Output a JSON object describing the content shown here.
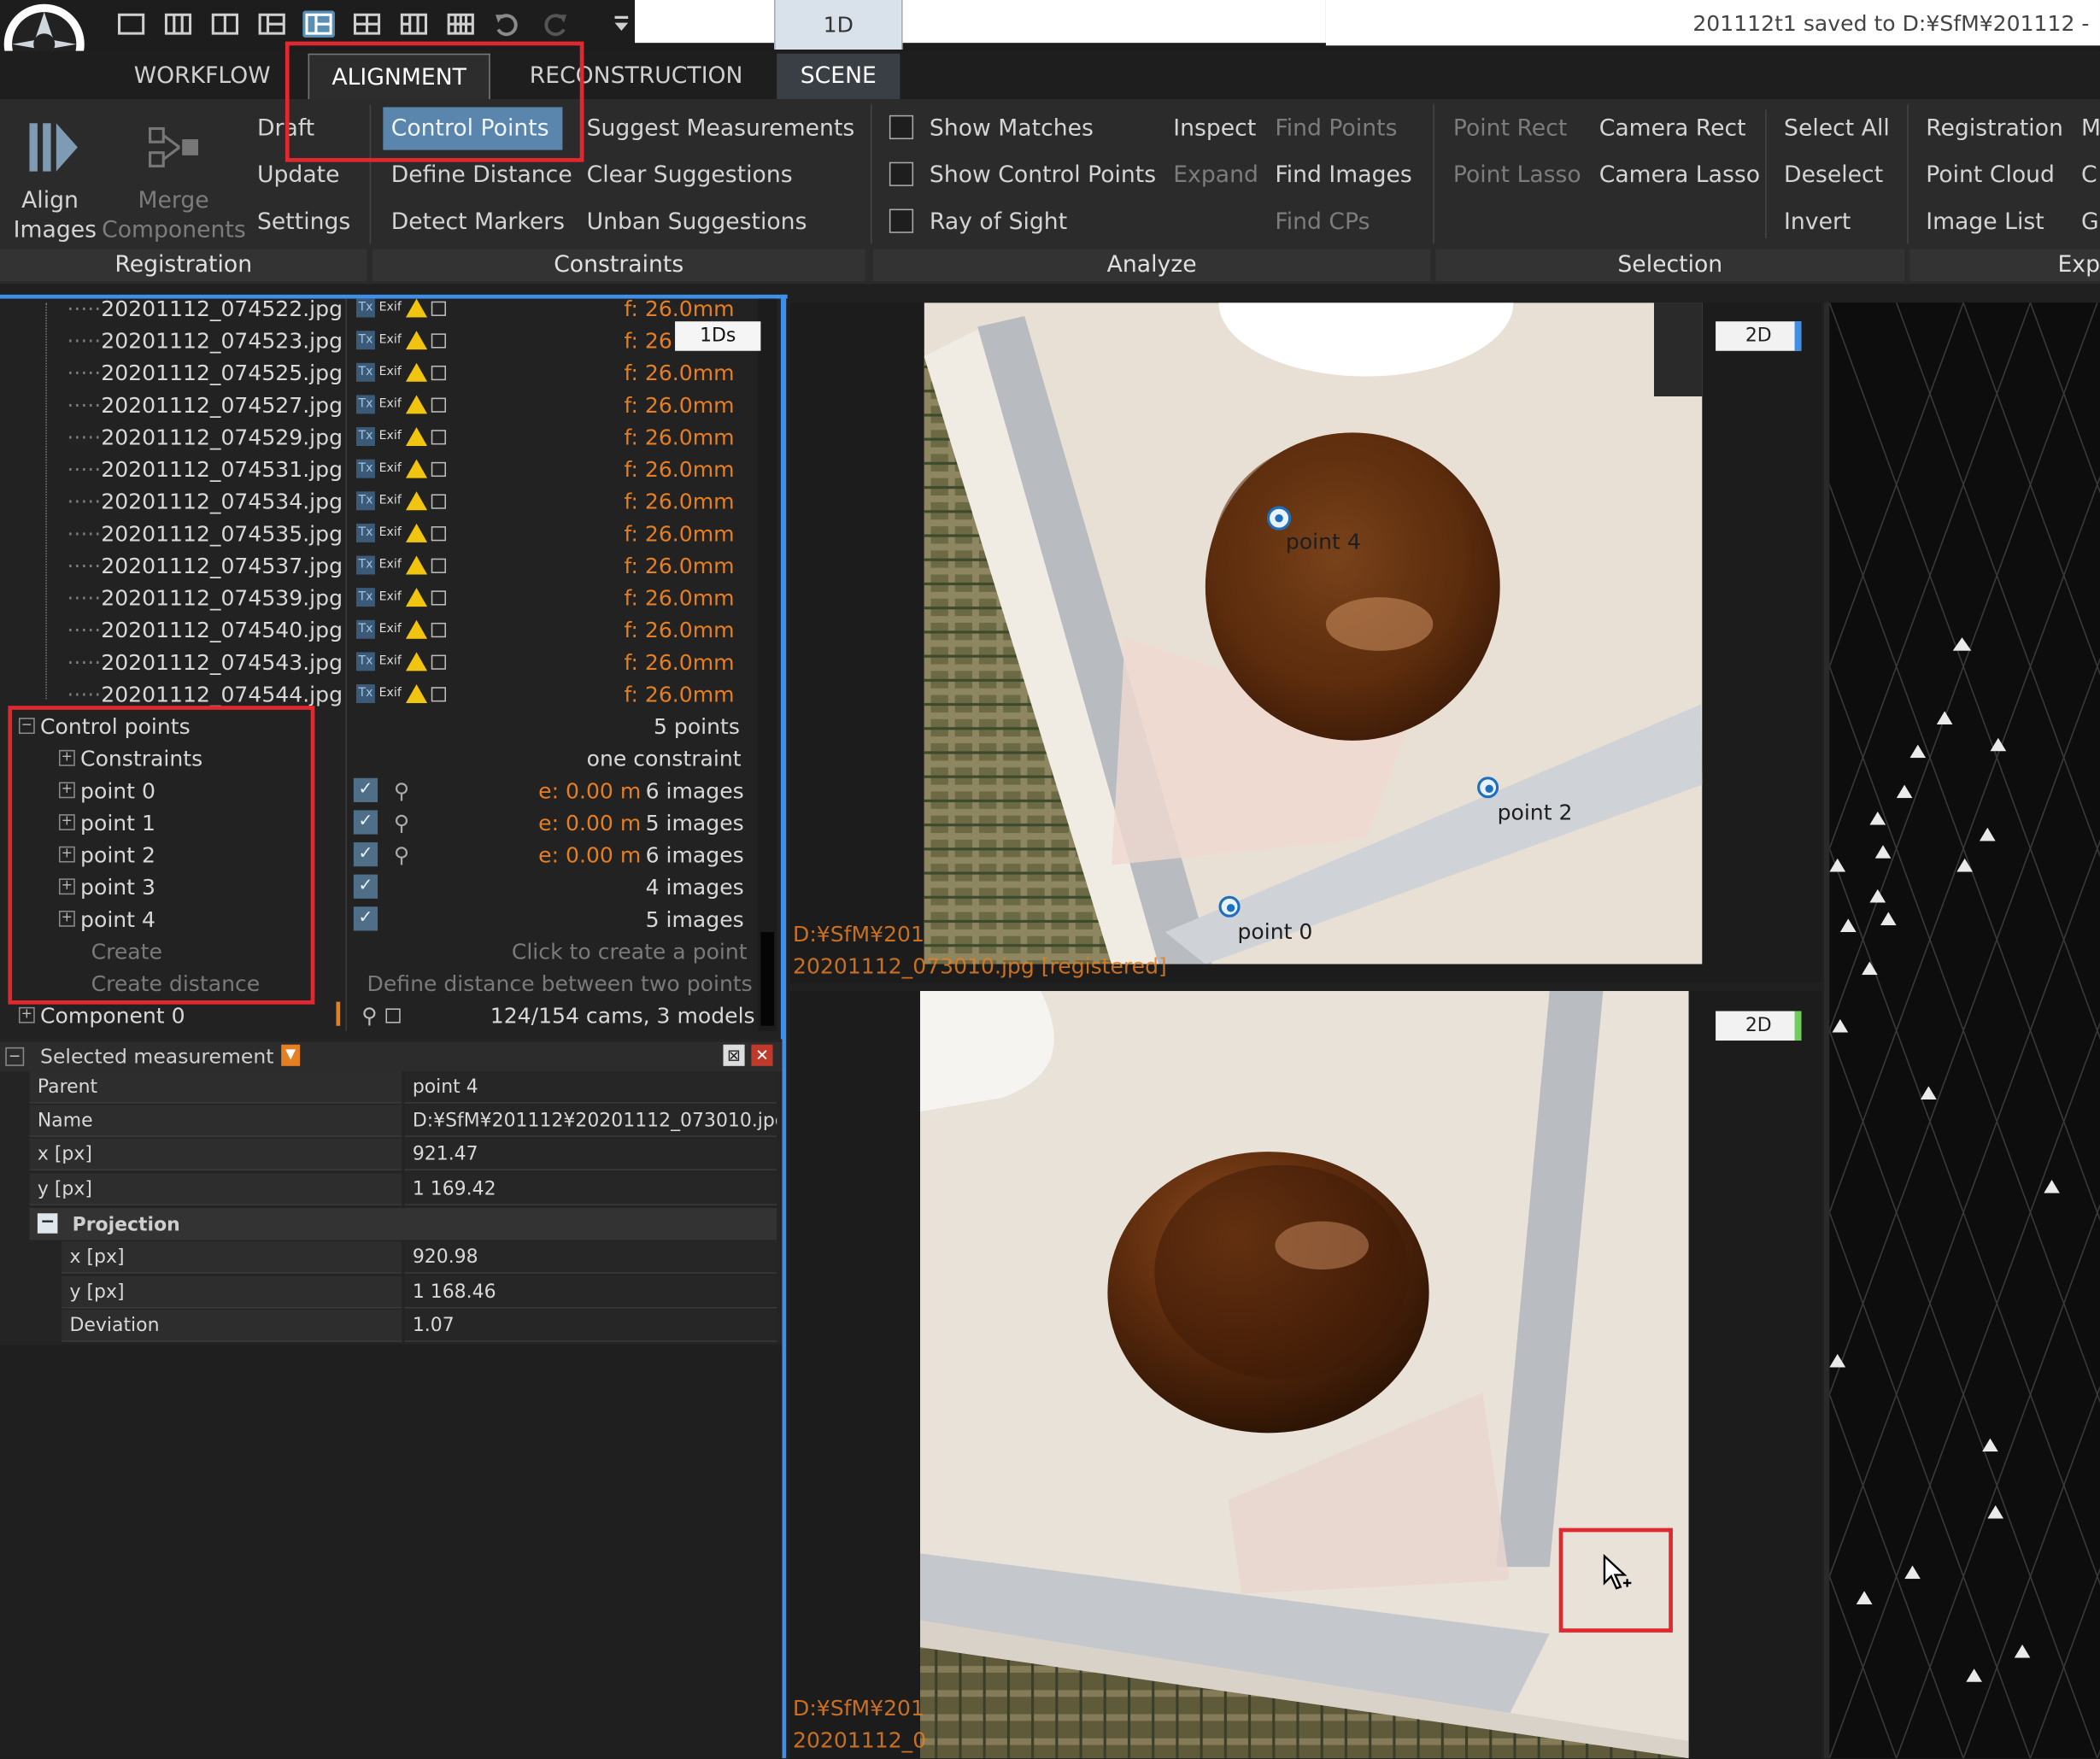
{
  "window": {
    "save_status": "201112t1 saved to D:¥SfM¥201112 -"
  },
  "quick_access": {
    "tab_1d": "1D",
    "icons": [
      "layout-1-icon",
      "layout-2-icon",
      "layout-3-icon",
      "layout-4-icon",
      "layout-5-icon",
      "layout-6-icon",
      "layout-7-icon",
      "layout-8-icon",
      "undo-icon",
      "redo-icon",
      "menu-icon"
    ]
  },
  "tabs": [
    "WORKFLOW",
    "ALIGNMENT",
    "RECONSTRUCTION",
    "SCENE"
  ],
  "ribbon": {
    "registration": {
      "align_images": [
        "Align",
        "Images"
      ],
      "merge_components": [
        "Merge",
        "Components"
      ],
      "draft": "Draft",
      "update": "Update",
      "settings": "Settings",
      "group": "Registration"
    },
    "constraints": {
      "control_points": "Control Points",
      "define_distance": "Define Distance",
      "detect_markers": "Detect Markers",
      "suggest_measurements": "Suggest Measurements",
      "clear_suggestions": "Clear Suggestions",
      "unban_suggestions": "Unban Suggestions",
      "group": "Constraints"
    },
    "analyze": {
      "show_matches": "Show Matches",
      "show_control_points": "Show Control Points",
      "ray_of_sight": "Ray of Sight",
      "inspect": "Inspect",
      "expand": "Expand",
      "find_points": "Find Points",
      "find_images": "Find Images",
      "find_cps": "Find CPs",
      "group": "Analyze"
    },
    "selection": {
      "point_rect": "Point Rect",
      "point_lasso": "Point Lasso",
      "camera_rect": "Camera Rect",
      "camera_lasso": "Camera Lasso",
      "select_all": "Select All",
      "deselect": "Deselect",
      "invert": "Invert",
      "group": "Selection"
    },
    "export": {
      "registration": "Registration",
      "point_cloud": "Point Cloud",
      "image_list": "Image List",
      "m": "M",
      "c": "C",
      "g": "G",
      "group": "Exp"
    }
  },
  "tree": {
    "images": [
      {
        "name": "20201112_074522.jpg",
        "focal": "f: 26.0mm"
      },
      {
        "name": "20201112_074523.jpg",
        "focal": "f: 26"
      },
      {
        "name": "20201112_074525.jpg",
        "focal": "f: 26.0mm"
      },
      {
        "name": "20201112_074527.jpg",
        "focal": "f: 26.0mm"
      },
      {
        "name": "20201112_074529.jpg",
        "focal": "f: 26.0mm"
      },
      {
        "name": "20201112_074531.jpg",
        "focal": "f: 26.0mm"
      },
      {
        "name": "20201112_074534.jpg",
        "focal": "f: 26.0mm"
      },
      {
        "name": "20201112_074535.jpg",
        "focal": "f: 26.0mm"
      },
      {
        "name": "20201112_074537.jpg",
        "focal": "f: 26.0mm"
      },
      {
        "name": "20201112_074539.jpg",
        "focal": "f: 26.0mm"
      },
      {
        "name": "20201112_074540.jpg",
        "focal": "f: 26.0mm"
      },
      {
        "name": "20201112_074543.jpg",
        "focal": "f: 26.0mm"
      },
      {
        "name": "20201112_074544.jpg",
        "focal": "f: 26.0mm"
      }
    ],
    "tooltip": "1Ds",
    "control_points": {
      "label": "Control points",
      "count": "5 points"
    },
    "constraints": {
      "label": "Constraints",
      "summary": "one constraint"
    },
    "points": [
      {
        "name": "point 0",
        "error": "e: 0.00 m",
        "images": "6 images"
      },
      {
        "name": "point 1",
        "error": "e: 0.00 m",
        "images": "5 images"
      },
      {
        "name": "point 2",
        "error": "e: 0.00 m",
        "images": "6 images"
      },
      {
        "name": "point 3",
        "error": "",
        "images": "4 images"
      },
      {
        "name": "point 4",
        "error": "",
        "images": "5 images"
      }
    ],
    "create": {
      "label": "Create",
      "hint": "Click to create a point"
    },
    "create_distance": {
      "label": "Create distance",
      "hint": "Define distance between two points"
    },
    "component": {
      "label": "Component 0",
      "summary": "124/154 cams, 3 models"
    }
  },
  "properties": {
    "title": "Selected measurement",
    "rows": [
      {
        "key": "Parent",
        "value": "point 4"
      },
      {
        "key": "Name",
        "value": "D:¥SfM¥201112¥20201112_073010.jpg"
      },
      {
        "key": "x [px]",
        "value": "921.47"
      },
      {
        "key": "y [px]",
        "value": "1 169.42"
      }
    ],
    "projection": {
      "label": "Projection",
      "rows": [
        {
          "key": "x [px]",
          "value": "920.98"
        },
        {
          "key": "y [px]",
          "value": "1 168.46"
        },
        {
          "key": "Deviation",
          "value": "1.07"
        }
      ]
    }
  },
  "views": {
    "top": {
      "badge": "2D",
      "path": "D:¥SfM¥201",
      "file": "20201112_073010.jpg [registered]",
      "points": [
        "point 4",
        "point 2",
        "point 0"
      ]
    },
    "bottom": {
      "badge": "2D",
      "path": "D:¥SfM¥201",
      "file": "20201112_0"
    }
  },
  "colors": {
    "accent": "#3d8fe8",
    "highlight": "#e0282e",
    "orange": "#e67e22"
  }
}
